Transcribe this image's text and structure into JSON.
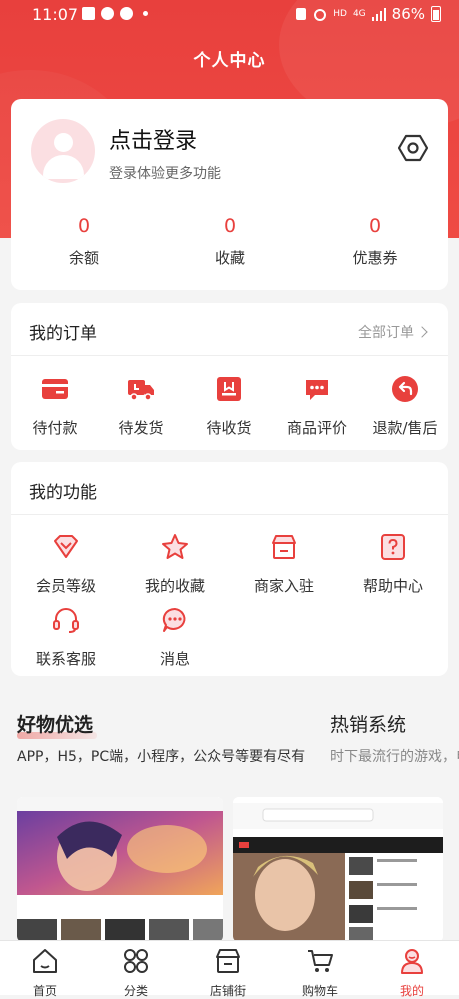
{
  "statusbar": {
    "time": "11:07",
    "network_small": "HD",
    "network_type": "4G",
    "battery": "86%"
  },
  "header": {
    "title": "个人中心"
  },
  "profile": {
    "login_label": "点击登录",
    "login_sub": "登录体验更多功能",
    "stats": [
      {
        "value": "0",
        "label": "余额"
      },
      {
        "value": "0",
        "label": "收藏"
      },
      {
        "value": "0",
        "label": "优惠券"
      }
    ]
  },
  "orders": {
    "title": "我的订单",
    "all_label": "全部订单",
    "items": [
      {
        "label": "待付款",
        "icon": "card-icon"
      },
      {
        "label": "待发货",
        "icon": "truck-icon"
      },
      {
        "label": "待收货",
        "icon": "package-icon"
      },
      {
        "label": "商品评价",
        "icon": "comment-icon"
      },
      {
        "label": "退款/售后",
        "icon": "return-icon"
      }
    ]
  },
  "functions": {
    "title": "我的功能",
    "items": [
      {
        "label": "会员等级",
        "icon": "vip-diamond-icon"
      },
      {
        "label": "我的收藏",
        "icon": "star-icon"
      },
      {
        "label": "商家入驻",
        "icon": "store-icon"
      },
      {
        "label": "帮助中心",
        "icon": "help-icon"
      },
      {
        "label": "联系客服",
        "icon": "headset-icon"
      },
      {
        "label": "消息",
        "icon": "message-icon"
      }
    ]
  },
  "sections": {
    "left": {
      "title": "好物优选",
      "subtitle": "APP，H5，PC端，小程序，公众号等要有尽有"
    },
    "right": {
      "title": "热销系统",
      "subtitle": "时下最流行的游戏，电"
    }
  },
  "tabbar": {
    "items": [
      {
        "label": "首页",
        "icon": "home-icon"
      },
      {
        "label": "分类",
        "icon": "grid-icon"
      },
      {
        "label": "店铺街",
        "icon": "shop-icon"
      },
      {
        "label": "购物车",
        "icon": "cart-icon"
      },
      {
        "label": "我的",
        "icon": "user-icon"
      }
    ],
    "active_index": 4
  },
  "colors": {
    "accent": "#e8403d",
    "avatar_bg": "#fbdfe2",
    "page_bg": "#f4f4f4"
  }
}
